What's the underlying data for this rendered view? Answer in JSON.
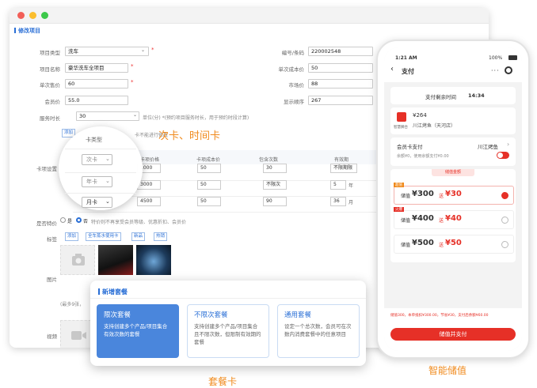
{
  "form": {
    "section_title": "修改项目",
    "fields": {
      "type": {
        "label": "项目类型",
        "value": "洗车"
      },
      "name": {
        "label": "项目名称",
        "value": "豪华洗车全项目"
      },
      "price": {
        "label": "单次售价",
        "value": "60"
      },
      "member_price": {
        "label": "会员价",
        "value": "55.0"
      },
      "duration": {
        "label": "服务时长",
        "value": "30",
        "unit_hint": "单位(分) *(预约项目服务时长，用于预约时段计算)"
      },
      "code": {
        "label": "编号/条码",
        "value": "220002548"
      },
      "cost": {
        "label": "单次成本价",
        "value": "50"
      },
      "market_price": {
        "label": "市场价",
        "value": "88"
      },
      "order": {
        "label": "显示顺序",
        "value": "267"
      }
    },
    "card_settings": {
      "label": "卡项设置",
      "add_button": "添加",
      "note_tail": "卡不能进行修改",
      "columns": [
        "卡项价格",
        "卡项成本价",
        "包含次数",
        "有效期"
      ],
      "rows": [
        {
          "price": "1000",
          "cost": "50",
          "count": "30",
          "validity": "不限期限",
          "unit": ""
        },
        {
          "price": "3000",
          "cost": "50",
          "count": "不限次",
          "validity": "5",
          "unit": "年"
        },
        {
          "price": "4500",
          "cost": "50",
          "count": "90",
          "validity": "36",
          "unit": "月"
        }
      ]
    },
    "special": {
      "label": "是否特价",
      "opt_no": "是",
      "opt_yes": "否",
      "hint": "特价则不再享受会员等级、优惠折扣、会员价"
    },
    "tags": {
      "label": "标签",
      "add": "添加",
      "items": [
        "全车蒸水使用卡",
        "新品",
        "热销"
      ]
    },
    "images": {
      "label": "图片"
    },
    "video": {
      "label": "视频",
      "hint": "(最多9张，"
    }
  },
  "magnifier": {
    "title": "卡类型",
    "options": [
      "次卡",
      "年卡",
      "月卡"
    ]
  },
  "captions": {
    "card_time": "次卡、时间卡",
    "package": "套餐卡",
    "stored_value": "智能储值"
  },
  "package_popup": {
    "title": "新增套餐",
    "cards": [
      {
        "title": "限次套餐",
        "desc": "支持创建多个产品/项目集合有效次数的套餐"
      },
      {
        "title": "不限次套餐",
        "desc": "支持创建多个产品/项目集合且不限次数，但限制有效期的套餐"
      },
      {
        "title": "通用套餐",
        "desc": "设定一个总次数，会员可在次数内消费套餐中的任意项目"
      }
    ]
  },
  "phone": {
    "time": "1:21 AM",
    "battery": "100%",
    "title": "支付",
    "countdown_label": "支付剩余时间",
    "countdown": "14:34",
    "logo_text": "智慧狮合",
    "amount": "¥264",
    "shop": "川江烤鱼（天河店）",
    "member_pay": "会员卡支付",
    "member_shop": "川江烤鱼",
    "balance_line": "余额¥0，使用余额支付¥0.00",
    "stored_label": "储值金额",
    "options": [
      {
        "badge": "超值",
        "store": "储值",
        "amount": "¥300",
        "gift_prefix": "送",
        "gift": "¥30",
        "selected": true
      },
      {
        "badge": "火爆",
        "store": "储值",
        "amount": "¥400",
        "gift_prefix": "送",
        "gift": "¥40",
        "selected": false
      },
      {
        "badge": "",
        "store": "储值",
        "amount": "¥500",
        "gift_prefix": "送",
        "gift": "¥50",
        "selected": false
      }
    ],
    "summary": "储值300，本单抵扣¥300.00，节省¥30，支付后余额¥60.00",
    "pay_button": "储值并支付"
  },
  "colors": {
    "accent": "#2a6fd6",
    "orange": "#f08a1c",
    "red": "#e63027"
  }
}
